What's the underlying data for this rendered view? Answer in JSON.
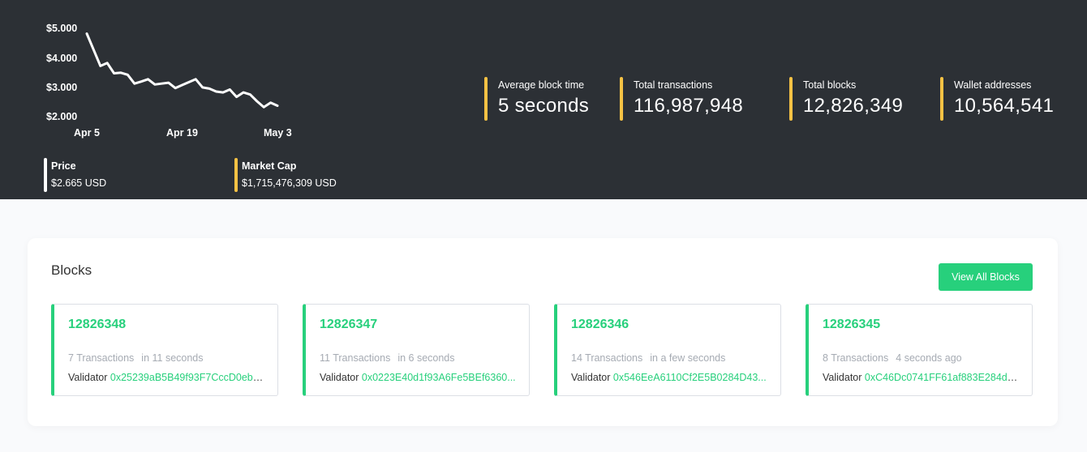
{
  "chart_data": {
    "type": "line",
    "y_ticks": [
      "$5.000",
      "$4.000",
      "$3.000",
      "$2.000"
    ],
    "x_ticks": [
      "Apr 5",
      "Apr 19",
      "May 3"
    ],
    "ylim": [
      2.0,
      5.0
    ],
    "line_color": "#ffffff",
    "series": [
      {
        "values": [
          4.85,
          4.3,
          3.75,
          3.85,
          3.5,
          3.52,
          3.45,
          3.15,
          3.22,
          3.3,
          3.12,
          3.15,
          3.18,
          3.0,
          3.1,
          3.2,
          3.3,
          3.02,
          2.98,
          2.88,
          2.85,
          2.95,
          2.7,
          2.85,
          2.78,
          2.55,
          2.35,
          2.5,
          2.4
        ]
      }
    ]
  },
  "market": {
    "price_label": "Price",
    "price_value": "$2.665 USD",
    "price_bar_color": "#ffffff",
    "mcap_label": "Market Cap",
    "mcap_value": "$1,715,476,309 USD",
    "mcap_bar_color": "#f7c244"
  },
  "stats": [
    {
      "label": "Average block time",
      "value": "5 seconds"
    },
    {
      "label": "Total transactions",
      "value": "116,987,948"
    },
    {
      "label": "Total blocks",
      "value": "12,826,349"
    },
    {
      "label": "Wallet addresses",
      "value": "10,564,541"
    }
  ],
  "blocks_section": {
    "title": "Blocks",
    "view_all_label": "View All Blocks",
    "accent_color": "#27d07c",
    "validator_label": "Validator",
    "items": [
      {
        "number": "12826348",
        "transactions": "7 Transactions",
        "time": "in 11 seconds",
        "validator": "0x25239aB5B49f93F7CccD0ebE..."
      },
      {
        "number": "12826347",
        "transactions": "11 Transactions",
        "time": "in 6 seconds",
        "validator": "0x0223E40d1f93A6Fe5BEf6360..."
      },
      {
        "number": "12826346",
        "transactions": "14 Transactions",
        "time": "in a few seconds",
        "validator": "0x546EeA6110Cf2E5B0284D43..."
      },
      {
        "number": "12826345",
        "transactions": "8 Transactions",
        "time": "4 seconds ago",
        "validator": "0xC46Dc0741FF61af883E284da..."
      }
    ]
  }
}
